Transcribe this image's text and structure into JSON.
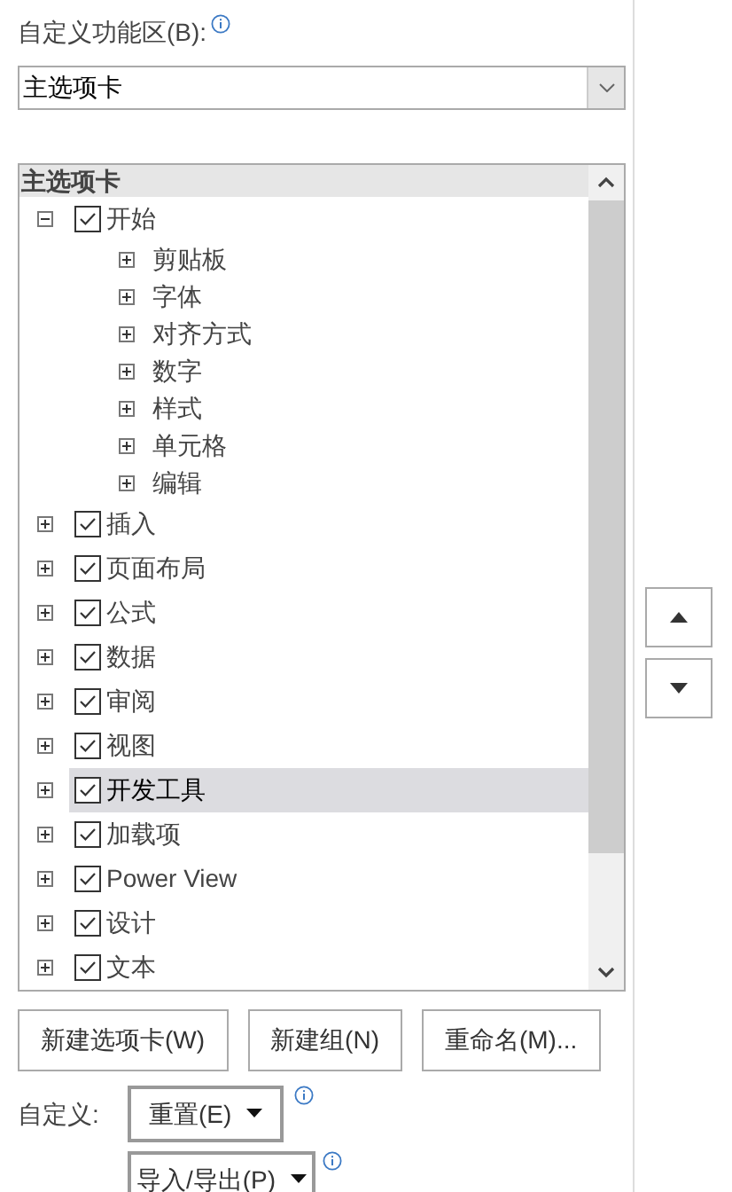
{
  "customize_label": "自定义功能区(B):",
  "ribbon_select": {
    "value": "主选项卡"
  },
  "tree": {
    "header": "主选项卡",
    "items": [
      {
        "kind": "tab",
        "label": "开始",
        "checked": true,
        "expanded": true,
        "selected": false,
        "children": [
          {
            "kind": "group",
            "label": "剪贴板",
            "expanded": false
          },
          {
            "kind": "group",
            "label": "字体",
            "expanded": false
          },
          {
            "kind": "group",
            "label": "对齐方式",
            "expanded": false
          },
          {
            "kind": "group",
            "label": "数字",
            "expanded": false
          },
          {
            "kind": "group",
            "label": "样式",
            "expanded": false
          },
          {
            "kind": "group",
            "label": "单元格",
            "expanded": false
          },
          {
            "kind": "group",
            "label": "编辑",
            "expanded": false
          }
        ]
      },
      {
        "kind": "tab",
        "label": "插入",
        "checked": true,
        "expanded": false,
        "selected": false
      },
      {
        "kind": "tab",
        "label": "页面布局",
        "checked": true,
        "expanded": false,
        "selected": false
      },
      {
        "kind": "tab",
        "label": "公式",
        "checked": true,
        "expanded": false,
        "selected": false
      },
      {
        "kind": "tab",
        "label": "数据",
        "checked": true,
        "expanded": false,
        "selected": false
      },
      {
        "kind": "tab",
        "label": "审阅",
        "checked": true,
        "expanded": false,
        "selected": false
      },
      {
        "kind": "tab",
        "label": "视图",
        "checked": true,
        "expanded": false,
        "selected": false
      },
      {
        "kind": "tab",
        "label": "开发工具",
        "checked": true,
        "expanded": false,
        "selected": true
      },
      {
        "kind": "tab",
        "label": "加载项",
        "checked": true,
        "expanded": false,
        "selected": false
      },
      {
        "kind": "tab",
        "label": "Power View",
        "checked": true,
        "expanded": false,
        "selected": false
      },
      {
        "kind": "tab",
        "label": "设计",
        "checked": true,
        "expanded": false,
        "selected": false
      },
      {
        "kind": "tab",
        "label": "文本",
        "checked": true,
        "expanded": false,
        "selected": false
      }
    ]
  },
  "buttons": [
    "新建选项卡(W)",
    "新建组(N)",
    "重命名(M)..."
  ],
  "customize": {
    "label": "自定义:",
    "reset_button": "重置(E)",
    "import_export_button": "导入/导出(P)"
  }
}
